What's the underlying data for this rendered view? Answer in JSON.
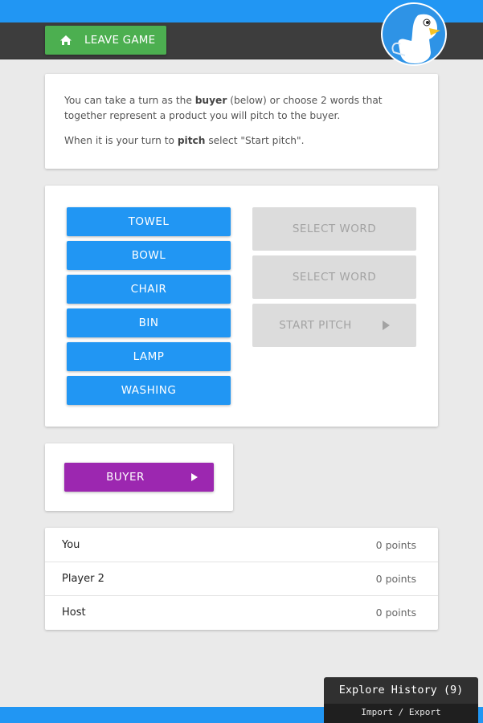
{
  "header": {
    "leave_label": "LEAVE GAME"
  },
  "intro": {
    "p1_before": "You can take a turn as the ",
    "p1_bold": "buyer",
    "p1_after": " (below) or choose 2 words that together represent a product you will pitch to the buyer.",
    "p2_before": "When it is your turn to ",
    "p2_bold": "pitch",
    "p2_after": " select \"Start pitch\"."
  },
  "words": [
    "TOWEL",
    "BOWL",
    "CHAIR",
    "BIN",
    "LAMP",
    "WASHING"
  ],
  "slots": {
    "select1": "SELECT WORD",
    "select2": "SELECT WORD",
    "start_pitch": "START PITCH"
  },
  "buyer": {
    "label": "BUYER"
  },
  "scores": [
    {
      "name": "You",
      "points": "0 points"
    },
    {
      "name": "Player 2",
      "points": "0 points"
    },
    {
      "name": "Host",
      "points": "0 points"
    }
  ],
  "history": {
    "title": "Explore History (9)",
    "sub": "Import / Export"
  },
  "colors": {
    "primary": "#2196f3",
    "leave": "#4caf50",
    "buyer": "#9c27b0",
    "header": "#3d3d3d",
    "disabled": "#dcdcdc"
  },
  "icons": {
    "leave": "home-icon",
    "start_pitch": "play-arrow-icon",
    "buyer": "play-arrow-icon"
  }
}
